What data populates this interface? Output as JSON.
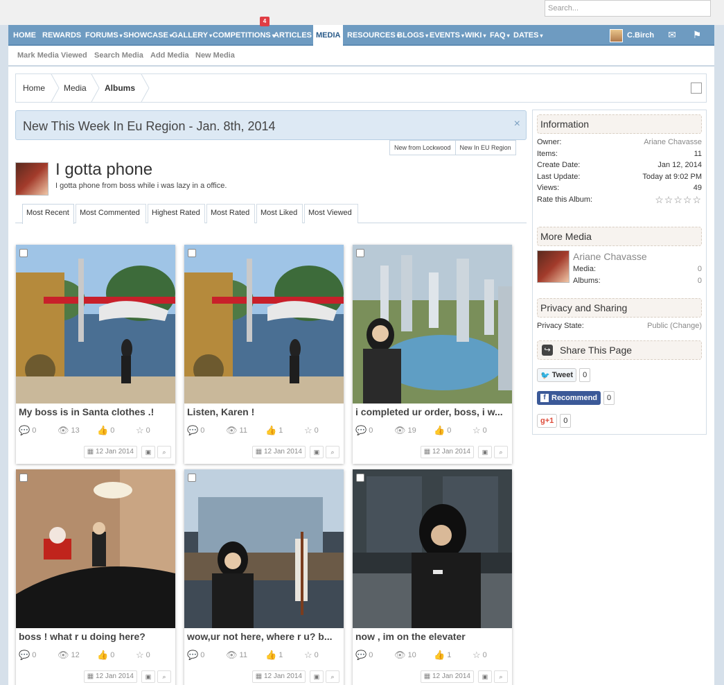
{
  "search": {
    "placeholder": "Search..."
  },
  "nav": {
    "items": [
      {
        "label": "HOME",
        "caret": ""
      },
      {
        "label": "REWARDS",
        "caret": ""
      },
      {
        "label": "FORUMS",
        "caret": "▾"
      },
      {
        "label": "SHOWCASE",
        "caret": "▾"
      },
      {
        "label": "GALLERY",
        "caret": "▾"
      },
      {
        "label": "COMPETITIONS",
        "caret": "▾"
      },
      {
        "label": "ARTICLES",
        "caret": "▾"
      },
      {
        "label": "MEDIA",
        "caret": ""
      },
      {
        "label": "RESOURCES",
        "caret": "▾"
      },
      {
        "label": "BLOGS",
        "caret": "▾"
      },
      {
        "label": "EVENTS",
        "caret": "▾"
      },
      {
        "label": "WIKI",
        "caret": "▾"
      },
      {
        "label": "FAQ",
        "caret": "▾"
      },
      {
        "label": "DATES",
        "caret": "▾"
      }
    ],
    "badge": "4",
    "user": "C.Birch",
    "icons": [
      "envelope-icon",
      "flag-icon"
    ]
  },
  "subnav": [
    "Mark Media Viewed",
    "Search Media",
    "Add Media",
    "New Media"
  ],
  "breadcrumb": [
    "Home",
    "Media",
    "Albums"
  ],
  "notice": {
    "title": "New This Week In Eu Region - Jan. 8th, 2014",
    "close": "×",
    "tabs": [
      "New from Lockwood",
      "New In EU Region"
    ]
  },
  "album": {
    "title": "I gotta phone",
    "description": "I gotta phone from boss while i was lazy in a office."
  },
  "tabs": [
    "Most Recent",
    "Most Commented",
    "Highest Rated",
    "Most Rated",
    "Most Liked",
    "Most Viewed"
  ],
  "media": [
    {
      "title": "My boss is in Santa clothes .!",
      "comments": "0",
      "views": "13",
      "likes": "0",
      "rating": "0",
      "date": "12 Jan 2014",
      "scene": "boat"
    },
    {
      "title": "Listen, Karen !",
      "comments": "0",
      "views": "11",
      "likes": "1",
      "rating": "0",
      "date": "12 Jan 2014",
      "scene": "boat"
    },
    {
      "title": "i completed ur order, boss, i w...",
      "comments": "0",
      "views": "19",
      "likes": "0",
      "rating": "0",
      "date": "12 Jan 2014",
      "scene": "city"
    },
    {
      "title": "boss ! what r u doing here?",
      "comments": "0",
      "views": "12",
      "likes": "0",
      "rating": "0",
      "date": "12 Jan 2014",
      "scene": "office"
    },
    {
      "title": "wow,ur not here, where r u? b...",
      "comments": "0",
      "views": "11",
      "likes": "1",
      "rating": "0",
      "date": "12 Jan 2014",
      "scene": "window"
    },
    {
      "title": "now , im on the elevater",
      "comments": "0",
      "views": "10",
      "likes": "1",
      "rating": "0",
      "date": "12 Jan 2014",
      "scene": "elevator"
    }
  ],
  "sidebar": {
    "info_title": "Information",
    "info": [
      {
        "label": "Owner:",
        "value": "Ariane Chavasse"
      },
      {
        "label": "Items:",
        "value": "11"
      },
      {
        "label": "Create Date:",
        "value": "Jan 12, 2014"
      },
      {
        "label": "Last Update:",
        "value": "Today at 9:02 PM"
      },
      {
        "label": "Views:",
        "value": "49"
      }
    ],
    "rate_label": "Rate this Album:",
    "rating": 0,
    "more_title": "More Media",
    "owner": "Ariane Chavasse",
    "owner_stats": [
      {
        "label": "Media:",
        "value": "0"
      },
      {
        "label": "Albums:",
        "value": "0"
      }
    ],
    "privacy_title": "Privacy and Sharing",
    "privacy_label": "Privacy State:",
    "privacy_value": "Public (Change)",
    "share_title": "Share This Page",
    "tweet": "Tweet",
    "tweet_count": "0",
    "recommend": "Recommend",
    "recommend_count": "0",
    "gplus": "+1",
    "gplus_count": "0"
  },
  "colors": {
    "nav": "#6e9bc1",
    "accent": "#2a5b8a",
    "badge": "#e03d44",
    "facebook": "#3b5998"
  }
}
